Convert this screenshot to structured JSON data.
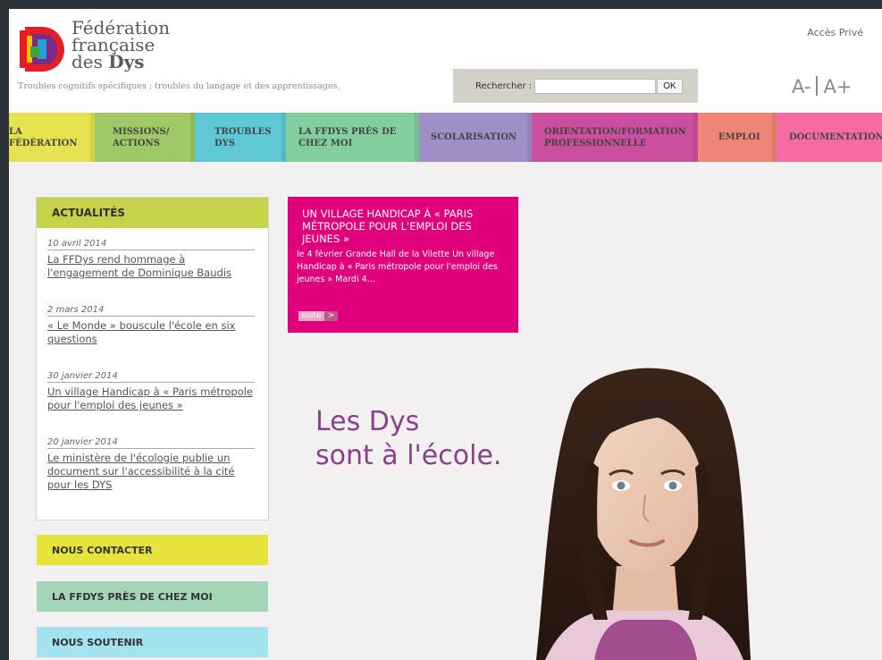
{
  "header": {
    "logo_lines": [
      "Fédération",
      "française",
      "des",
      "Dys"
    ],
    "tagline": "Troubles cognitifs spécifiques ; troubles du langage et des apprentissages.",
    "acces_prive": "Accès Privé",
    "search": {
      "label": "Rechercher :",
      "value": "",
      "button": "OK"
    },
    "font_size": {
      "decrease": "A-",
      "increase": "A+"
    }
  },
  "nav": {
    "items": [
      {
        "label": "LA FÉDÉRATION",
        "color": "#e6e14f"
      },
      {
        "label": "MISSIONS/ ACTIONS",
        "color": "#9fc966"
      },
      {
        "label": "TROUBLES DYS",
        "color": "#5ec8d5"
      },
      {
        "label": "LA FFDYS PRÈS DE CHEZ MOI",
        "color": "#82ce9e"
      },
      {
        "label": "SCOLARISATION",
        "color": "#a08fc7"
      },
      {
        "label": "ORIENTATION/FORMATION PROFESSIONNELLE",
        "color": "#cc4e9f"
      },
      {
        "label": "EMPLOI",
        "color": "#ee8577"
      },
      {
        "label": "DOCUMENTATION",
        "color": "#f66ba4"
      }
    ]
  },
  "actualites": {
    "title": "ACTUALITÉS",
    "items": [
      {
        "date": "10 avril 2014",
        "text": "La FFDys rend hommage à l'engagement de Dominique Baudis"
      },
      {
        "date": "2 mars 2014",
        "text": "« Le Monde » bouscule l'école en six questions"
      },
      {
        "date": "30 janvier 2014",
        "text": "Un village Handicap à « Paris métropole pour l'emploi des jeunes »"
      },
      {
        "date": "20 janvier 2014",
        "text": "Le ministère de l'écologie publie un document sur l'accessibilité à la cité pour les DYS"
      }
    ]
  },
  "side_blocks": [
    {
      "label": "NOUS CONTACTER",
      "color": "#e6e43c"
    },
    {
      "label": "LA FFDYS PRÈS DE CHEZ MOI",
      "color": "#a2d6b7"
    },
    {
      "label": "NOUS SOUTENIR",
      "color": "#a3e3f0"
    }
  ],
  "feature": {
    "title": "UN VILLAGE HANDICAP À « PARIS MÉTROPOLE POUR L'EMPLOI DES JEUNES »",
    "text": "le 4 février Grande Hall de la Vilette Un village Handicap à « Paris métropole pour l'emploi des jeunes » Mardi 4...",
    "button": "suite",
    "arrow": ">"
  },
  "slogan": {
    "line1": "Les Dys",
    "line2": "sont à l'école."
  },
  "colors": {
    "feature_bg": "#e0007b",
    "actualites_head": "#c6d34a",
    "slogan": "#8a3f8f"
  }
}
